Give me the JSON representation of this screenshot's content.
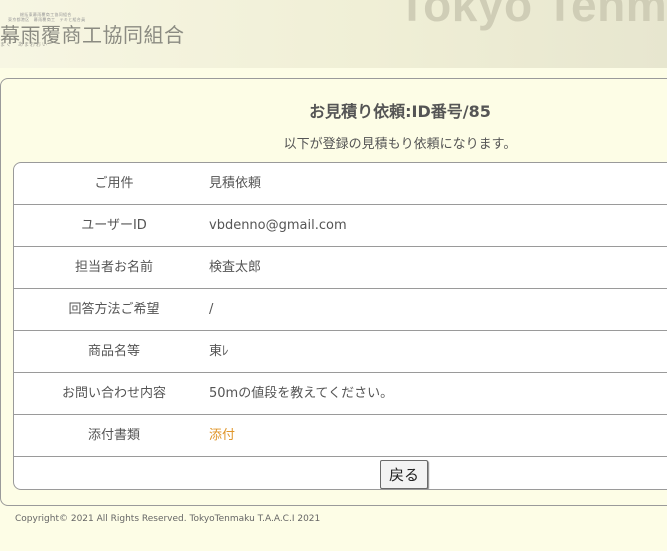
{
  "header": {
    "logo_small_line1": "総括東幕雨覆商工協同組合",
    "logo_small_line2": "東京都港区　幕雨覆商工　テキと組合員",
    "logo_main": "幕雨覆商工協同組合",
    "logo_kana": "まく　あまおおい",
    "brand": "Tokyo Tenmaku"
  },
  "page": {
    "title": "お見積り依頼:ID番号/85",
    "subtitle": "以下が登録の見積もり依頼になります。"
  },
  "rows": [
    {
      "label": "ご用件",
      "value": "見積依頼"
    },
    {
      "label": "ユーザーID",
      "value": "vbdenno@gmail.com"
    },
    {
      "label": "担当者お名前",
      "value": "検査太郎"
    },
    {
      "label": "回答方法ご希望",
      "value": "/"
    },
    {
      "label": "商品名等",
      "value": "東ﾚ"
    },
    {
      "label": "お問い合わせ内容",
      "value": "50mの値段を教えてください。"
    },
    {
      "label": "添付書類",
      "value": "添付"
    }
  ],
  "back_button_label": "戻る",
  "footer": "Copyright© 2021 All Rights Reserved. TokyoTenmaku T.A.A.C.I 2021",
  "colors": {
    "background": "#fdfde6",
    "link": "#e0962a",
    "border": "#9a9a9a"
  }
}
